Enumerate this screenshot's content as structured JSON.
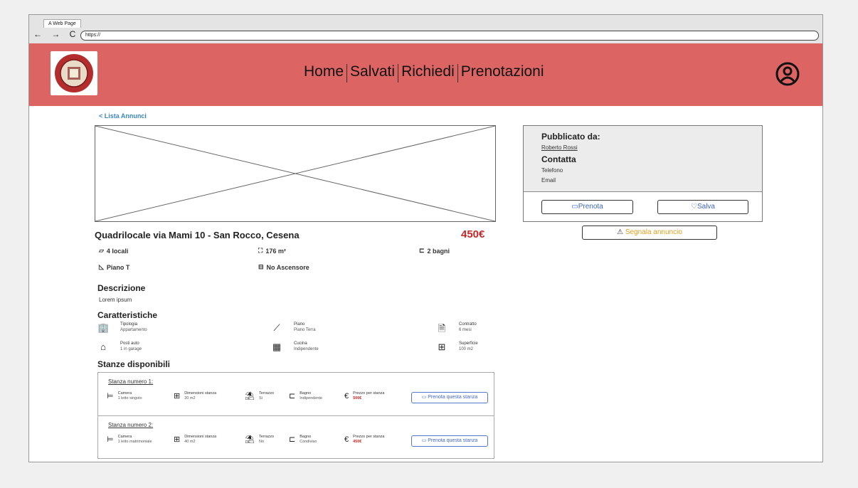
{
  "browser": {
    "tab_title": "A Web Page",
    "url": "https://",
    "nav_buttons": "← → C"
  },
  "header": {
    "nav": [
      "Home",
      "Salvati",
      "Richiedi",
      "Prenotazioni"
    ]
  },
  "back_link": "< Lista Annunci",
  "listing": {
    "title": "Quadrilocale via Mami 10 - San Rocco, Cesena",
    "price": "450€",
    "features": {
      "locali": "4 locali",
      "mq": "176 m²",
      "bagni": "2 bagni",
      "piano": "Piano T",
      "ascensore": "No Ascensore"
    },
    "description_heading": "Descrizione",
    "description_text": "Lorem ipsum",
    "characteristics_heading": "Caratteristiche",
    "characteristics": [
      {
        "label": "Tipologia",
        "value": "Appartamento",
        "icon": "building-icon",
        "glyph": "🏢"
      },
      {
        "label": "Piano",
        "value": "Piano Terra",
        "icon": "stairs-icon",
        "glyph": "⟋"
      },
      {
        "label": "Contratto",
        "value": "6 mesi",
        "icon": "document-icon",
        "glyph": "🗎"
      },
      {
        "label": "Posti auto",
        "value": "1 in garage",
        "icon": "garage-icon",
        "glyph": "⌂"
      },
      {
        "label": "Cucina",
        "value": "Indipendente",
        "icon": "kitchen-icon",
        "glyph": "▦"
      },
      {
        "label": "Superficie",
        "value": "100 m2",
        "icon": "area-icon",
        "glyph": "⊞"
      }
    ],
    "rooms_heading": "Stanze disponibili",
    "rooms": [
      {
        "title": "Stanza numero 1:",
        "camera_label": "Camera",
        "camera_value": "1 letto singolo",
        "dim_label": "Dimensioni stanza",
        "dim_value": "20 m2",
        "terrazzo_label": "Terrazzo",
        "terrazzo_value": "Si",
        "bagno_label": "Bagno",
        "bagno_value": "Indipendente",
        "prezzo_label": "Prezzo per stanza",
        "prezzo_value": "500€",
        "button": "Prenota questa stanza"
      },
      {
        "title": "Stanza numero 2:",
        "camera_label": "Camera",
        "camera_value": "1 letto matrimoniale",
        "dim_label": "Dimensioni stanza",
        "dim_value": "40 m2",
        "terrazzo_label": "Terrazzo",
        "terrazzo_value": "No",
        "bagno_label": "Bagno",
        "bagno_value": "Condiviso",
        "prezzo_label": "Prezzo per stanza",
        "prezzo_value": "450€",
        "button": "Prenota questa stanza"
      }
    ]
  },
  "panel": {
    "published_by": "Pubblicato da:",
    "owner": "Roberto Rossi",
    "contact_heading": "Contatta",
    "telefono": "Telefono",
    "email": "Email",
    "prenota_button": "Prenota",
    "salva_button": "Salva",
    "segnala_button": "Segnala annuncio"
  },
  "colors": {
    "header": "#dc6463",
    "price": "#c62828",
    "link": "#3b86c4",
    "warning": "#e0a020"
  }
}
